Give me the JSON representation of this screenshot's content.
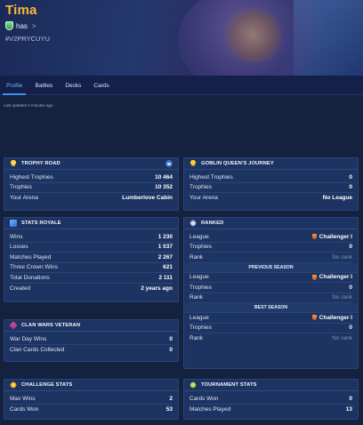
{
  "player": {
    "name": "Tima",
    "clan": "has",
    "clan_chevron": ">",
    "tag": "#V2PRYCUYU"
  },
  "tabs": [
    {
      "label": "Profile",
      "active": true
    },
    {
      "label": "Battles",
      "active": false
    },
    {
      "label": "Decks",
      "active": false
    },
    {
      "label": "Cards",
      "active": false
    }
  ],
  "last_updated": "Last updated 2 minutes ago",
  "cards": {
    "trophy_road": {
      "title": "TROPHY ROAD",
      "rows": [
        {
          "label": "Highest Trophies",
          "value": "10 464"
        },
        {
          "label": "Trophies",
          "value": "10 352"
        },
        {
          "label": "Your Arena",
          "value": "Lumberlove Cabin"
        }
      ]
    },
    "goblin": {
      "title": "GOBLIN QUEEN'S JOURNEY",
      "rows": [
        {
          "label": "Highest Trophies",
          "value": "0"
        },
        {
          "label": "Trophies",
          "value": "0"
        },
        {
          "label": "Your Arena",
          "value": "No League"
        }
      ]
    },
    "stats_royale": {
      "title": "STATS ROYALE",
      "rows": [
        {
          "label": "Wins",
          "value": "1 230"
        },
        {
          "label": "Losses",
          "value": "1 037"
        },
        {
          "label": "Matches Played",
          "value": "2 267"
        },
        {
          "label": "Three Crown Wins",
          "value": "621"
        },
        {
          "label": "Total Donations",
          "value": "2 111"
        },
        {
          "label": "Created",
          "value": "2 years ago"
        }
      ]
    },
    "ranked": {
      "title": "RANKED",
      "current": [
        {
          "label": "League",
          "value": "Challenger I"
        },
        {
          "label": "Trophies",
          "value": "0"
        },
        {
          "label": "Rank",
          "value": "No rank"
        }
      ],
      "previous_title": "PREVIOUS SEASON",
      "previous": [
        {
          "label": "League",
          "value": "Challenger I"
        },
        {
          "label": "Trophies",
          "value": "0"
        },
        {
          "label": "Rank",
          "value": "No rank"
        }
      ],
      "best_title": "BEST SEASON",
      "best": [
        {
          "label": "League",
          "value": "Challenger I"
        },
        {
          "label": "Trophies",
          "value": "0"
        },
        {
          "label": "Rank",
          "value": "No rank"
        }
      ]
    },
    "clan_wars": {
      "title": "CLAN WARS VETERAN",
      "rows": [
        {
          "label": "War Day Wins",
          "value": "0"
        },
        {
          "label": "Clan Cards Collected",
          "value": "0"
        }
      ]
    },
    "challenge": {
      "title": "CHALLENGE STATS",
      "rows": [
        {
          "label": "Max Wins",
          "value": "2"
        },
        {
          "label": "Cards Won",
          "value": "53"
        }
      ]
    },
    "tournament": {
      "title": "TOURNAMENT STATS",
      "rows": [
        {
          "label": "Cards Won",
          "value": "0"
        },
        {
          "label": "Matches Played",
          "value": "13"
        }
      ]
    }
  },
  "colors": {
    "name": "#ffb636",
    "background": "#14213f",
    "card": "#1d3462",
    "active_tab": "#6fb7ff"
  },
  "icons": [
    "trophy-icon",
    "goblin-crown-icon",
    "stats-icon",
    "ranked-icon",
    "clan-wars-icon",
    "challenge-icon",
    "tournament-icon",
    "league-icon",
    "chest-icon"
  ]
}
